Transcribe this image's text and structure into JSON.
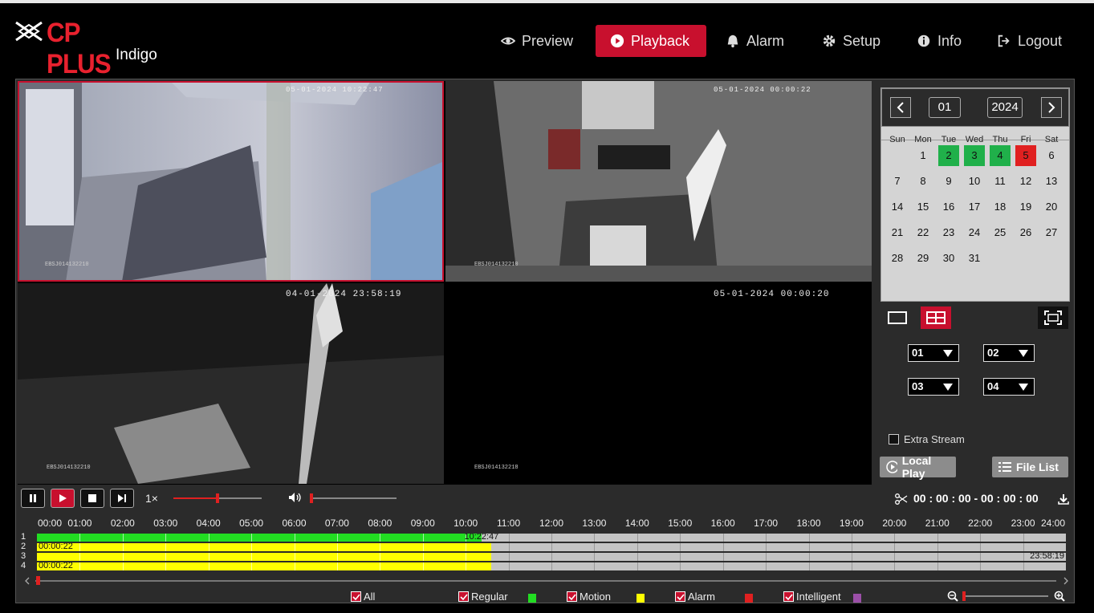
{
  "brand": {
    "name": "CP PLUS",
    "sub": "Indigo"
  },
  "nav": [
    {
      "label": "Preview",
      "icon": "eye-icon",
      "active": false
    },
    {
      "label": "Playback",
      "icon": "play-circle-icon",
      "active": true
    },
    {
      "label": "Alarm",
      "icon": "bell-icon",
      "active": false
    },
    {
      "label": "Setup",
      "icon": "gear-icon",
      "active": false
    },
    {
      "label": "Info",
      "icon": "info-icon",
      "active": false
    },
    {
      "label": "Logout",
      "icon": "logout-icon",
      "active": false
    }
  ],
  "colors": {
    "accent": "#c8102e",
    "record_regular": "#22dd22",
    "record_motion": "#ffff00",
    "record_alarm": "#e02020",
    "record_intelligent": "#9b4fa8"
  },
  "video": {
    "tiles": [
      {
        "timestamp": "05-01-2024 10:22:47",
        "cam_id": "EBSJ014132210",
        "selected": true
      },
      {
        "timestamp": "05-01-2024 00:00:22",
        "cam_id": "EBSJ014132210",
        "selected": false
      },
      {
        "timestamp": "04-01-2024 23:58:19",
        "cam_id": "EBSJ014132210",
        "selected": false
      },
      {
        "timestamp": "05-01-2024 00:00:20",
        "cam_id": "EBSJ014132218",
        "selected": false
      }
    ]
  },
  "calendar": {
    "month": "01",
    "year": "2024",
    "weekdays": [
      "Sun",
      "Mon",
      "Tue",
      "Wed",
      "Thu",
      "Fri",
      "Sat"
    ],
    "days": [
      "1",
      "2",
      "3",
      "4",
      "5",
      "6",
      "7",
      "8",
      "9",
      "10",
      "11",
      "12",
      "13",
      "14",
      "15",
      "16",
      "17",
      "18",
      "19",
      "20",
      "21",
      "22",
      "23",
      "24",
      "25",
      "26",
      "27",
      "28",
      "29",
      "30",
      "31"
    ],
    "first_weekday": 1,
    "recorded_days": [
      "2",
      "3",
      "4"
    ],
    "selected_day": "5"
  },
  "layout_buttons": [
    "single-view-icon",
    "quad-view-icon",
    "fullscreen-icon"
  ],
  "channels": [
    "01",
    "02",
    "03",
    "04"
  ],
  "extra_stream": {
    "label": "Extra Stream",
    "checked": false
  },
  "buttons": {
    "local_play": "Local Play",
    "file_list": "File List"
  },
  "playback": {
    "speed": "1×",
    "progress": 0.5,
    "volume": 0.0,
    "clip_time": "00 : 00 : 00 - 00 : 00 : 00"
  },
  "timeline": {
    "hours": [
      "00:00",
      "01:00",
      "02:00",
      "03:00",
      "04:00",
      "05:00",
      "06:00",
      "07:00",
      "08:00",
      "09:00",
      "10:00",
      "11:00",
      "12:00",
      "13:00",
      "14:00",
      "15:00",
      "16:00",
      "17:00",
      "18:00",
      "19:00",
      "20:00",
      "21:00",
      "22:00",
      "23:00",
      "24:00"
    ],
    "rows": [
      {
        "label": "1",
        "type": "regular",
        "end_hour": 10.38,
        "marker": "10:22:47",
        "marker_side": "end"
      },
      {
        "label": "2",
        "type": "motion",
        "end_hour": 10.6,
        "marker": "00:00:22",
        "marker_side": "start"
      },
      {
        "label": "3",
        "type": "motion",
        "end_hour": 10.6,
        "marker": "23:58:19",
        "marker_side": "right"
      },
      {
        "label": "4",
        "type": "motion",
        "end_hour": 10.6,
        "marker": "00:00:22",
        "marker_side": "start"
      }
    ]
  },
  "legend": [
    {
      "label": "All",
      "checked": true
    },
    {
      "label": "Regular",
      "checked": true,
      "color": "#22dd22"
    },
    {
      "label": "Motion",
      "checked": true,
      "color": "#ffff00"
    },
    {
      "label": "Alarm",
      "checked": true,
      "color": "#e02020"
    },
    {
      "label": "Intelligent",
      "checked": true,
      "color": "#9b4fa8"
    }
  ]
}
